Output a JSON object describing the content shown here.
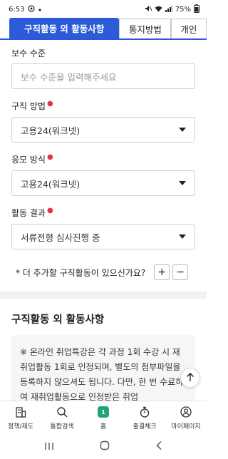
{
  "status_bar": {
    "time": "6:53",
    "battery": "75%"
  },
  "tabs": [
    {
      "label": "구직활동 외 활동사항",
      "active": true
    },
    {
      "label": "통지방법",
      "active": false
    },
    {
      "label": "개인",
      "active": false
    }
  ],
  "form": {
    "salary": {
      "label": "보수 수준",
      "placeholder": "보수 수준을 입력해주세요"
    },
    "method": {
      "label": "구직 방법",
      "value": "고용24(워크넷)"
    },
    "apply_method": {
      "label": "응모 방식",
      "value": "고용24(워크넷)"
    },
    "result": {
      "label": "활동 결과",
      "value": "서류전형 심사진행 중"
    },
    "add_more": {
      "text": "* 더 추가할 구직활동이 있으신가요?",
      "plus": "+",
      "minus": "−"
    }
  },
  "section": {
    "title": "구직활동 외 활동사항",
    "notice": "※ 온라인 취업특강은 각 과정 1회 수강 시 재취업활동 1회로 인정되며, 별도의 첨부파일을 등록하지 않으셔도 됩니다. 다만, 한 번 수료하여 재취업활동으로 인정받은 취업"
  },
  "bottom_nav": [
    {
      "label": "정책/제도",
      "icon": "building-icon"
    },
    {
      "label": "통합검색",
      "icon": "search-icon"
    },
    {
      "label": "홈",
      "icon": "home-icon",
      "badge": "1"
    },
    {
      "label": "출결체크",
      "icon": "stopwatch-icon"
    },
    {
      "label": "마이페이지",
      "icon": "person-icon"
    }
  ],
  "colors": {
    "accent": "#2b5bd9",
    "required": "#e0334f",
    "home_green": "#1ea67a"
  }
}
